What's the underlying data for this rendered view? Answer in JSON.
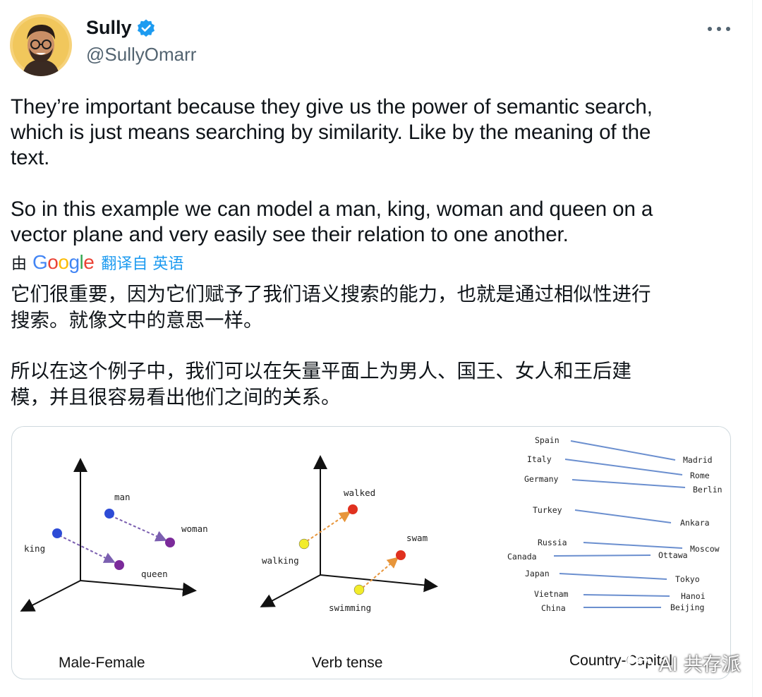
{
  "author": {
    "name": "Sully",
    "handle": "@SullyOmarr"
  },
  "tweet": {
    "paragraphs_en": [
      "They’re important because they give us the power of semantic search,\nwhich is just means searching by similarity. Like by the meaning of the\ntext.",
      "So in this example we can model a man, king, woman and queen on a\nvector plane and very easily see their relation to one another."
    ],
    "translation": {
      "prefix": "由",
      "provider": "Google",
      "link": "翻译自 英语"
    },
    "paragraphs_zh": [
      "它们很重要，因为它们赋予了我们语义搜索的能力，也就是通过相似性进行\n搜索。就像文中的意思一样。",
      "所以在这个例子中，我们可以在矢量平面上为男人、国王、女人和王后建\n模，并且很容易看出他们之间的关系。"
    ]
  },
  "figure": {
    "panels": [
      {
        "caption": "Male-Female",
        "points": [
          "man",
          "woman",
          "king",
          "queen"
        ]
      },
      {
        "caption": "Verb tense",
        "points": [
          "walked",
          "swam",
          "walking",
          "swimming"
        ]
      },
      {
        "caption": "Country-Capital"
      }
    ],
    "country_capital_pairs": [
      [
        "Spain",
        "Madrid"
      ],
      [
        "Italy",
        "Rome"
      ],
      [
        "Germany",
        "Berlin"
      ],
      [
        "Turkey",
        "Ankara"
      ],
      [
        "Russia",
        "Moscow"
      ],
      [
        "Canada",
        "Ottawa"
      ],
      [
        "Japan",
        "Tokyo"
      ],
      [
        "Vietnam",
        "Hanoi"
      ],
      [
        "China",
        "Beijing"
      ]
    ],
    "colors": {
      "male": "#2d4bd6",
      "female": "#7b2a9a",
      "past": "#e0311f",
      "present": "#f2ec2a",
      "pair_line": "#6b8fcf",
      "gender_arrow": "#7b5fb0",
      "tense_arrow": "#e7953a"
    }
  },
  "watermark": "AI 共存派",
  "icons": [
    "verified-badge-icon",
    "more-options-icon",
    "wechat-icon"
  ]
}
